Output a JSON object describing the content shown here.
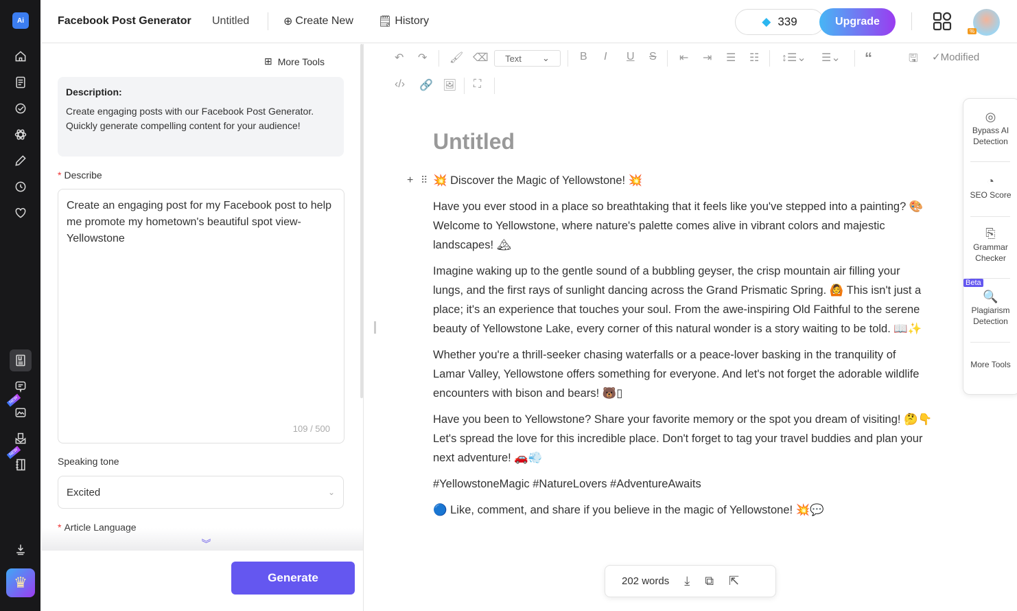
{
  "header": {
    "title": "Facebook Post Generator",
    "doc_name": "Untitled",
    "create_new": "Create New",
    "history": "History",
    "credits": "339",
    "upgrade": "Upgrade",
    "avatar_badge": "%"
  },
  "sidebar": {
    "icons": [
      "app-logo",
      "home",
      "documents",
      "tasks",
      "ai-tools",
      "edit",
      "history",
      "favorites",
      "post-generator",
      "chat",
      "image-new",
      "inbox",
      "notebook-new",
      "download",
      "premium-crown"
    ],
    "new_badge": "NEW"
  },
  "left": {
    "more_tools": "More Tools",
    "description_title": "Description:",
    "description_text": "Create engaging posts with our Facebook Post Generator. Quickly generate compelling content for your audience!",
    "describe_label": "Describe",
    "describe_value": "Create an engaging post for my Facebook post to help me promote my hometown's beautiful spot view-Yellowstone",
    "counter": "109 / 500",
    "tone_label": "Speaking tone",
    "tone_value": "Excited",
    "language_label": "Article Language",
    "generate": "Generate"
  },
  "toolbar": {
    "text_style": "Text",
    "status": "Modified"
  },
  "editor": {
    "title": "Untitled",
    "paragraphs": [
      [
        "💥 Discover the Magic of Yellowstone! 💥"
      ],
      [
        "Have you ever stood in a place so breathtaking that it feels like you've stepped into a painting? 🎨",
        "Welcome to Yellowstone, where nature's palette comes alive in vibrant colors and majestic",
        "landscapes! 🏔"
      ],
      [
        "Imagine waking up to the gentle sound of a bubbling geyser, the crisp mountain air filling your",
        "lungs, and the first rays of sunlight dancing across the Grand Prismatic Spring. 🙆 This isn't just a",
        "place; it's an experience that touches your soul. From the awe-inspiring Old Faithful to the serene",
        "beauty of Yellowstone Lake, every corner of this natural wonder is a story waiting to be told. 📖✨"
      ],
      [
        "Whether you're a thrill-seeker chasing waterfalls or a peace-lover basking in the tranquility of",
        "Lamar Valley, Yellowstone offers something for everyone. And let's not forget the adorable wildlife",
        "encounters with bison and bears! 🐻▯"
      ],
      [
        "Have you been to Yellowstone? Share your favorite memory or the spot you dream of visiting! 🤔👇",
        "Let's spread the love for this incredible place. Don't forget to tag your travel buddies and plan your",
        "next adventure! 🚗💨"
      ],
      [
        "#YellowstoneMagic #NatureLovers #AdventureAwaits"
      ],
      [
        "🔵 Like, comment, and share if you believe in the magic of Yellowstone! 💥💬"
      ]
    ]
  },
  "right_panel": {
    "items": [
      "Bypass AI Detection",
      "SEO Score",
      "Grammar Checker",
      "Plagiarism Detection",
      "More Tools"
    ],
    "beta": "Beta"
  },
  "footer": {
    "words": "202 words"
  },
  "colors": {
    "accent": "#6457f0",
    "sidebar": "#18181a",
    "upgrade_from": "#47b6f5",
    "upgrade_to": "#9a3cf0"
  }
}
